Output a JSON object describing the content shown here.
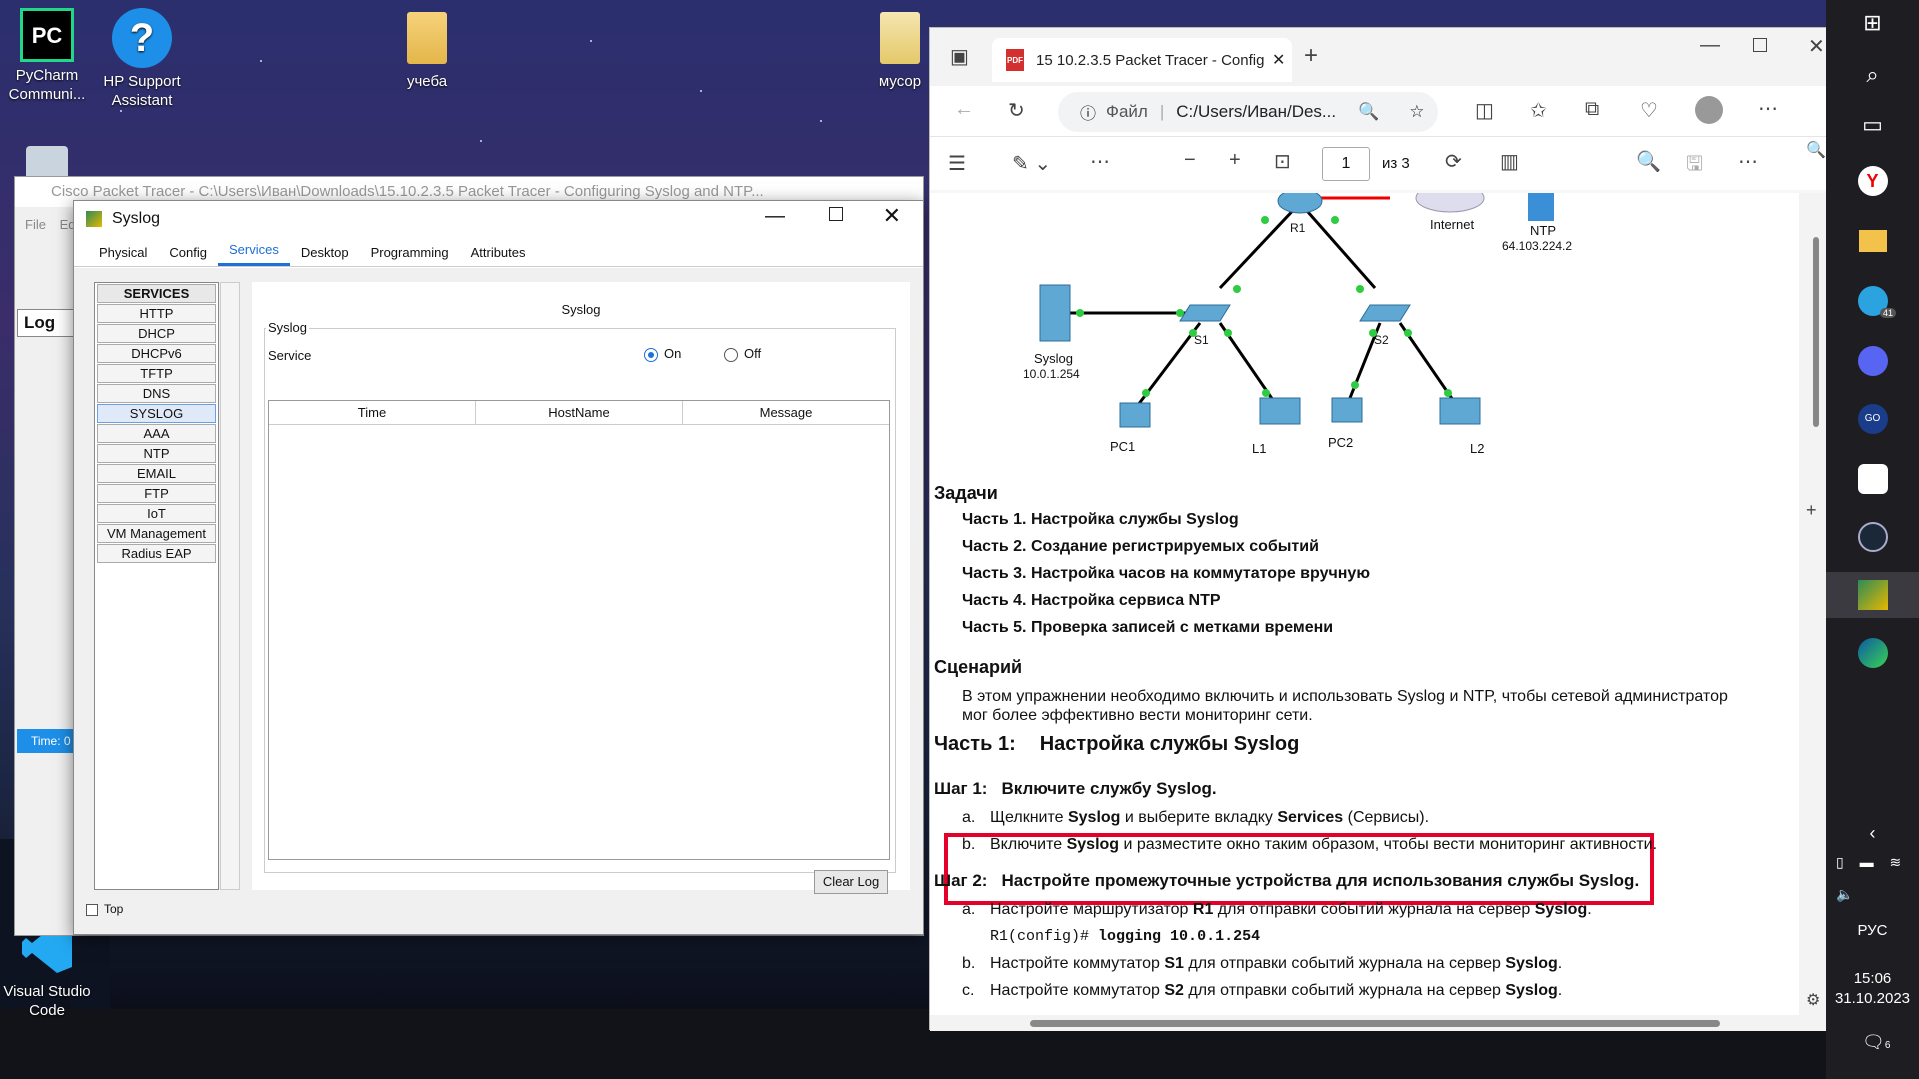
{
  "desktop": {
    "icons": [
      {
        "name": "pycharm",
        "label": "PyCharm Communi...",
        "glyph": "PC"
      },
      {
        "name": "hp-support",
        "label": "HP Support Assistant",
        "glyph": "?"
      },
      {
        "name": "ucheba-folder",
        "label": "учеба",
        "glyph": ""
      },
      {
        "name": "musor-folder",
        "label": "мусор",
        "glyph": ""
      },
      {
        "name": "vscode",
        "label": "Visual Studio Code",
        "glyph": ""
      }
    ]
  },
  "packet_tracer": {
    "title": "Cisco Packet Tracer - C:\\Users\\Иван\\Downloads\\15.10.2.3.5 Packet Tracer - Configuring Syslog and NTP...",
    "menu_file": "File",
    "menu_edit": "Ed",
    "log_label": "Log",
    "time_label": "Time: 0"
  },
  "syslog_dialog": {
    "title": "Syslog",
    "tabs": [
      "Physical",
      "Config",
      "Services",
      "Desktop",
      "Programming",
      "Attributes"
    ],
    "active_tab": "Services",
    "services_header": "SERVICES",
    "services": [
      "HTTP",
      "DHCP",
      "DHCPv6",
      "TFTP",
      "DNS",
      "SYSLOG",
      "AAA",
      "NTP",
      "EMAIL",
      "FTP",
      "IoT",
      "VM Management",
      "Radius EAP"
    ],
    "selected_service": "SYSLOG",
    "panel_title": "Syslog",
    "group_label": "Syslog",
    "service_label": "Service",
    "on_label": "On",
    "off_label": "Off",
    "service_state": "On",
    "columns": [
      "Time",
      "HostName",
      "Message"
    ],
    "clear_log": "Clear Log",
    "top_label": "Top"
  },
  "edge": {
    "tab_title": "15 10.2.3.5 Packet Tracer - Config",
    "address_label": "Файл",
    "address": "C:/Users/Иван/Des...",
    "page_current": "1",
    "page_total": "из 3",
    "diagram": {
      "r1": "R1",
      "internet": "Internet",
      "ntp": "NTP",
      "ntp_ip": "64.103.224.2",
      "syslog": "Syslog",
      "syslog_ip": "10.0.1.254",
      "s1": "S1",
      "s2": "S2",
      "pc1": "PC1",
      "l1": "L1",
      "pc2": "PC2",
      "l2": "L2"
    },
    "tasks_heading": "Задачи",
    "tasks": [
      "Часть 1. Настройка службы Syslog",
      "Часть 2. Создание регистрируемых событий",
      "Часть 3. Настройка часов на коммутаторе вручную",
      "Часть 4. Настройка сервиса NTP",
      "Часть 5. Проверка записей с метками времени"
    ],
    "scenario_heading": "Сценарий",
    "scenario_text": "В этом упражнении необходимо включить и использовать Syslog и NTP, чтобы сетевой администратор мог более эффективно вести мониторинг сети.",
    "part1_label": "Часть 1:",
    "part1_title": "Настройка службы Syslog",
    "step1_label": "Шаг 1:",
    "step1_title": "Включите службу Syslog.",
    "step1_a_mark": "a.",
    "step1_a_pre": "Щелкните ",
    "step1_a_b1": "Syslog",
    "step1_a_mid": " и выберите вкладку ",
    "step1_a_b2": "Services",
    "step1_a_post": " (Сервисы).",
    "step1_b_mark": "b.",
    "step1_b_pre": "Включите ",
    "step1_b_b1": "Syslog",
    "step1_b_post": " и разместите окно таким образом, чтобы вести мониторинг активности.",
    "step2_label": "Шаг 2:",
    "step2_title": "Настройте промежуточные устройства для использования службы Syslog.",
    "step2_a_mark": "a.",
    "step2_a_pre": "Настройте маршрутизатор ",
    "step2_a_b1": "R1",
    "step2_a_mid": " для отправки событий журнала на сервер ",
    "step2_a_b2": "Syslog",
    "step2_a_post": ".",
    "cmd_prompt": "R1(config)#",
    "cmd": "logging 10.0.1.254",
    "step2_b_mark": "b.",
    "step2_b_pre": "Настройте коммутатор ",
    "step2_b_b1": "S1",
    "step2_b_mid": " для отправки событий журнала на сервер ",
    "step2_b_b2": "Syslog",
    "step2_b_post": ".",
    "step2_c_mark": "c.",
    "step2_c_pre": "Настройте коммутатор ",
    "step2_c_b1": "S2",
    "step2_c_mid": " для отправки событий журнала на сервер ",
    "step2_c_b2": "Syslog",
    "step2_c_post": "."
  },
  "taskbar": {
    "lang": "РУС",
    "time": "15:06",
    "date": "31.10.2023",
    "notif_count": "6",
    "telegram_badge": "41"
  },
  "colors": {
    "accent": "#1e6fd6",
    "highlight_box": "#e5002a",
    "link_green": "#2ecc40"
  }
}
